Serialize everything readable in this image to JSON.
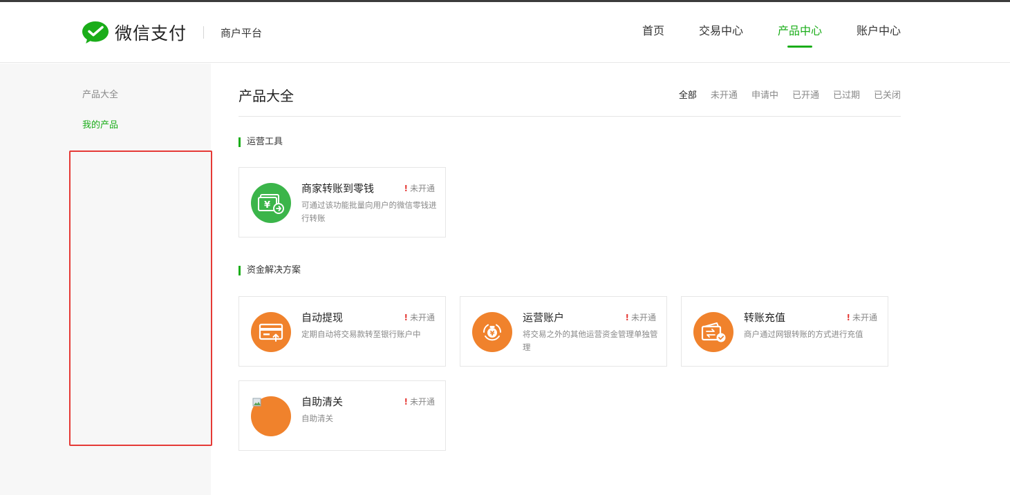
{
  "header": {
    "logo_text": "微信支付",
    "platform": "商户平台",
    "nav": [
      {
        "label": "首页",
        "active": false
      },
      {
        "label": "交易中心",
        "active": false
      },
      {
        "label": "产品中心",
        "active": true
      },
      {
        "label": "账户中心",
        "active": false
      }
    ]
  },
  "sidebar": {
    "items": [
      {
        "label": "产品大全",
        "active": false
      },
      {
        "label": "我的产品",
        "active": true
      }
    ]
  },
  "main": {
    "title": "产品大全",
    "filters": [
      "全部",
      "未开通",
      "申请中",
      "已开通",
      "已过期",
      "已关闭"
    ],
    "active_filter": "全部",
    "sections": [
      {
        "title": "运营工具",
        "products": [
          {
            "name": "商家转账到零钱",
            "status": "未开通",
            "desc": "可通过该功能批量向用户的微信零钱进行转账",
            "icon": "wallet-transfer-icon"
          }
        ]
      },
      {
        "title": "资金解决方案",
        "products": [
          {
            "name": "自动提现",
            "status": "未开通",
            "desc": "定期自动将交易款转至银行账户中",
            "icon": "card-withdraw-icon"
          },
          {
            "name": "运营账户",
            "status": "未开通",
            "desc": "将交易之外的其他运营资金管理单独管理",
            "icon": "money-bag-icon"
          },
          {
            "name": "转账充值",
            "status": "未开通",
            "desc": "商户通过网银转账的方式进行充值",
            "icon": "transfer-recharge-icon"
          },
          {
            "name": "自助清关",
            "status": "未开通",
            "desc": "自助清关",
            "icon": "broken-image-icon"
          }
        ]
      }
    ]
  },
  "colors": {
    "brand_green": "#1aad19",
    "icon_green": "#3bb54a",
    "icon_orange": "#f0822c",
    "status_red": "#e53935",
    "highlight_box": "#e53935"
  }
}
